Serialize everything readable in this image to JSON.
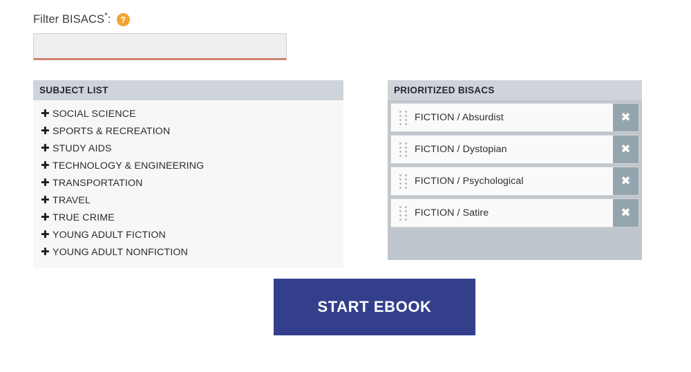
{
  "filter": {
    "label": "Filter BISACS",
    "required_marker": "*",
    "colon": ":",
    "help_icon_glyph": "?",
    "input_value": "",
    "input_placeholder": ""
  },
  "subject_panel": {
    "header": "SUBJECT LIST",
    "expand_glyph": "✚",
    "items": [
      {
        "label": "SOCIAL SCIENCE"
      },
      {
        "label": "SPORTS & RECREATION"
      },
      {
        "label": "STUDY AIDS"
      },
      {
        "label": "TECHNOLOGY & ENGINEERING"
      },
      {
        "label": "TRANSPORTATION"
      },
      {
        "label": "TRAVEL"
      },
      {
        "label": "TRUE CRIME"
      },
      {
        "label": "YOUNG ADULT FICTION"
      },
      {
        "label": "YOUNG ADULT NONFICTION"
      }
    ]
  },
  "prioritized_panel": {
    "header": "PRIORITIZED BISACS",
    "remove_glyph": "✖",
    "items": [
      {
        "label": "FICTION / Absurdist"
      },
      {
        "label": "FICTION / Dystopian"
      },
      {
        "label": "FICTION / Psychological"
      },
      {
        "label": "FICTION / Satire"
      }
    ]
  },
  "actions": {
    "start_label": "START EBOOK"
  },
  "colors": {
    "panel_header": "#ced4da",
    "prio_body": "#bfc6cd",
    "remove_button": "#95a5b0",
    "start_button": "#343f8c",
    "help_icon": "#f0a431",
    "input_underline": "#d08070"
  }
}
